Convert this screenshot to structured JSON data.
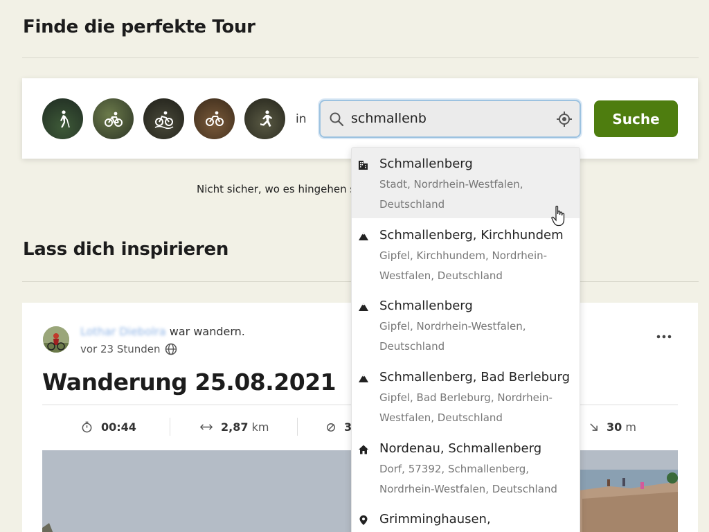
{
  "page": {
    "title": "Finde die perfekte Tour",
    "inspire_title": "Lass dich inspirieren",
    "unsure_text": "Nicht sicher, wo es hingehen s"
  },
  "search": {
    "sports": [
      "hiking-icon",
      "bike-icon",
      "mtb-icon",
      "gravel-icon",
      "running-icon"
    ],
    "in_label": "in",
    "query": "schmallenb",
    "button_label": "Suche",
    "accent_color": "#4e7d0f"
  },
  "suggestions": [
    {
      "icon": "city-icon",
      "title": "Schmallenberg",
      "sub1": "Stadt, Nordrhein-Westfalen,",
      "sub2": "Deutschland"
    },
    {
      "icon": "peak-icon",
      "title": "Schmallenberg, Kirchhundem",
      "sub1": "Gipfel, Kirchhundem, Nordrhein-",
      "sub2": "Westfalen, Deutschland"
    },
    {
      "icon": "peak-icon",
      "title": "Schmallenberg",
      "sub1": "Gipfel, Nordrhein-Westfalen,",
      "sub2": "Deutschland"
    },
    {
      "icon": "peak-icon",
      "title": "Schmallenberg, Bad Berleburg",
      "sub1": "Gipfel, Bad Berleburg, Nordrhein-",
      "sub2": "Westfalen, Deutschland"
    },
    {
      "icon": "home-icon",
      "title": "Nordenau, Schmallenberg",
      "sub1": "Dorf, 57392, Schmallenberg,",
      "sub2": "Nordrhein-Westfalen, Deutschland"
    },
    {
      "icon": "pin-icon",
      "title": "Grimminghausen,",
      "sub1": "",
      "sub2": ""
    }
  ],
  "post": {
    "author": "Lothar Diebolra",
    "action": "war wandern.",
    "time": "vor 23 Stunden",
    "title": "Wanderung 25.08.2021",
    "stats": {
      "duration": "00:44",
      "distance_value": "2,87",
      "distance_unit": "km",
      "speed_value": "3",
      "descent_value": "30",
      "descent_unit": "m"
    }
  }
}
